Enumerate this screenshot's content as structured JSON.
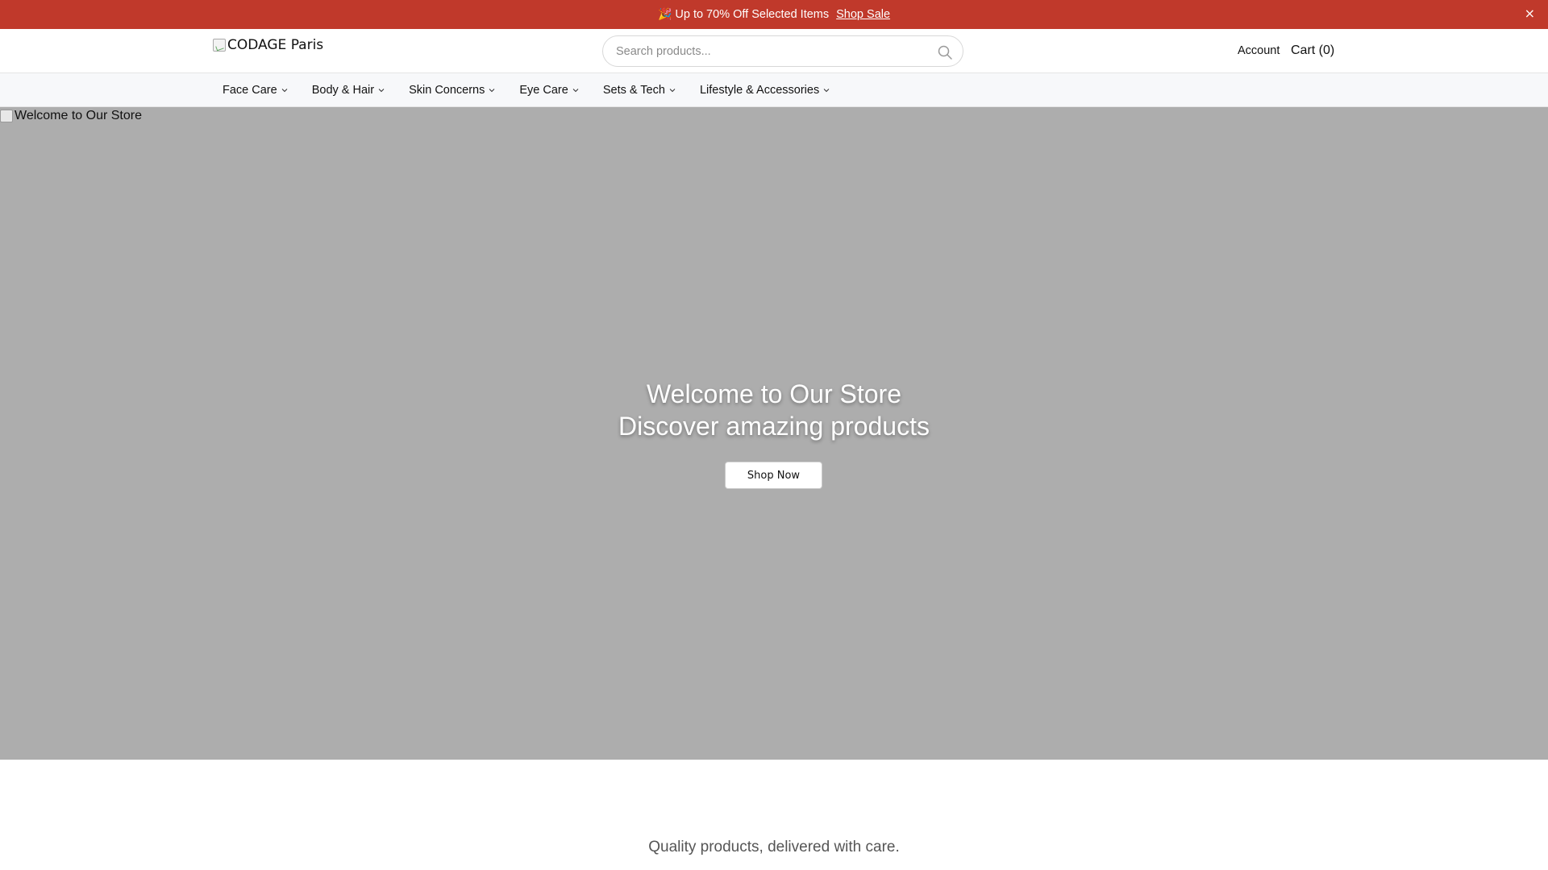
{
  "announcement": {
    "emoji": "🎉",
    "text": "Up to 70% Off Selected Items",
    "link": "Shop Sale",
    "close": "×",
    "bg_color": "#c0392b"
  },
  "header": {
    "logo_alt": "CODAGE Paris",
    "search_placeholder": "Search products...",
    "search_icon": "search-icon",
    "account": "Account",
    "cart": "Cart (0)"
  },
  "nav": {
    "items": [
      {
        "label": "Face Care"
      },
      {
        "label": "Body & Hair"
      },
      {
        "label": "Skin Concerns"
      },
      {
        "label": "Eye Care"
      },
      {
        "label": "Sets & Tech"
      },
      {
        "label": "Lifestyle & Accessories"
      }
    ]
  },
  "hero": {
    "image_alt": "Welcome to Our Store",
    "title_line1": "Welcome to Our Store",
    "title_line2": "Discover amazing products",
    "button": "Shop Now",
    "bg_color": "#adadad"
  },
  "tagline": "Quality products, delivered with care."
}
